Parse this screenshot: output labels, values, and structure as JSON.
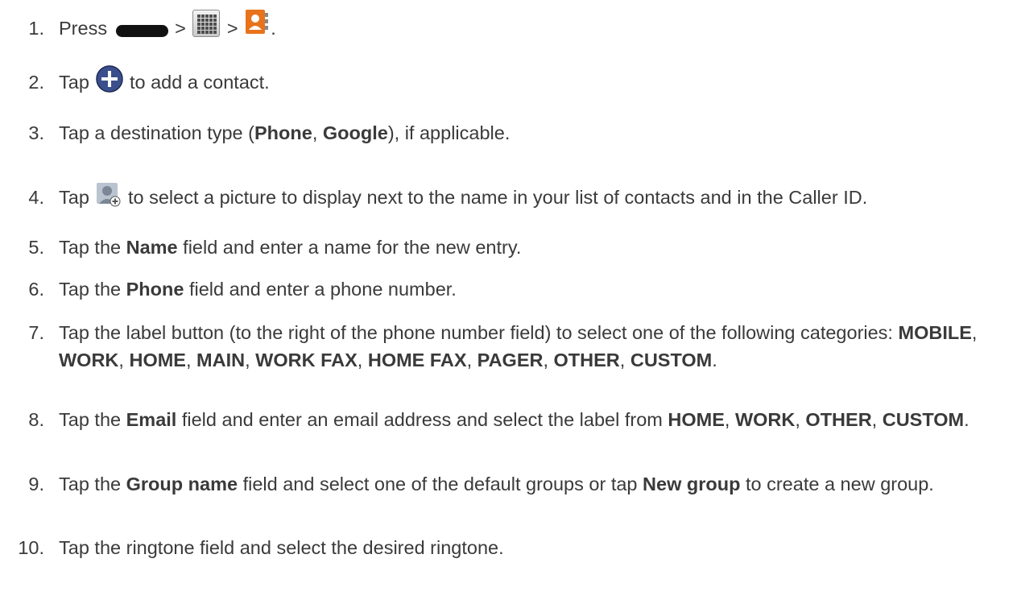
{
  "steps": [
    {
      "num": "1.",
      "parts": [
        {
          "t": "text",
          "v": "Press "
        },
        {
          "t": "icon",
          "name": "home-key-icon"
        },
        {
          "t": "text",
          "v": " > "
        },
        {
          "t": "icon",
          "name": "apps-icon"
        },
        {
          "t": "text",
          "v": " > "
        },
        {
          "t": "icon",
          "name": "contacts-icon"
        },
        {
          "t": "text",
          "v": "."
        }
      ]
    },
    {
      "num": "2.",
      "parts": [
        {
          "t": "text",
          "v": "Tap "
        },
        {
          "t": "icon",
          "name": "add-contact-icon"
        },
        {
          "t": "text",
          "v": " to add a contact."
        }
      ]
    },
    {
      "num": "3.",
      "parts": [
        {
          "t": "text",
          "v": "Tap a destination type ("
        },
        {
          "t": "bold",
          "v": "Phone"
        },
        {
          "t": "text",
          "v": ", "
        },
        {
          "t": "bold",
          "v": "Google"
        },
        {
          "t": "text",
          "v": "), if applicable."
        }
      ]
    },
    {
      "num": "4.",
      "parts": [
        {
          "t": "text",
          "v": "Tap "
        },
        {
          "t": "icon",
          "name": "contact-photo-icon"
        },
        {
          "t": "text",
          "v": " to select a picture to display next to the name in your list of contacts and in the Caller ID."
        }
      ]
    },
    {
      "num": "5.",
      "parts": [
        {
          "t": "text",
          "v": "Tap the "
        },
        {
          "t": "bold",
          "v": "Name"
        },
        {
          "t": "text",
          "v": " field and enter a name for the new entry."
        }
      ]
    },
    {
      "num": "6.",
      "parts": [
        {
          "t": "text",
          "v": "Tap the "
        },
        {
          "t": "bold",
          "v": "Phone"
        },
        {
          "t": "text",
          "v": " field and enter a phone number."
        }
      ]
    },
    {
      "num": "7.",
      "parts": [
        {
          "t": "text",
          "v": "Tap the label button (to the right of the phone number field) to select one of the following categories: "
        },
        {
          "t": "bold",
          "v": "MOBILE"
        },
        {
          "t": "text",
          "v": ", "
        },
        {
          "t": "bold",
          "v": "WORK"
        },
        {
          "t": "text",
          "v": ", "
        },
        {
          "t": "bold",
          "v": "HOME"
        },
        {
          "t": "text",
          "v": ", "
        },
        {
          "t": "bold",
          "v": "MAIN"
        },
        {
          "t": "text",
          "v": ", "
        },
        {
          "t": "bold",
          "v": "WORK FAX"
        },
        {
          "t": "text",
          "v": ", "
        },
        {
          "t": "bold",
          "v": "HOME FAX"
        },
        {
          "t": "text",
          "v": ", "
        },
        {
          "t": "bold",
          "v": "PAGER"
        },
        {
          "t": "text",
          "v": ", "
        },
        {
          "t": "bold",
          "v": "OTHER"
        },
        {
          "t": "text",
          "v": ", "
        },
        {
          "t": "bold",
          "v": "CUSTOM"
        },
        {
          "t": "text",
          "v": "."
        }
      ]
    },
    {
      "num": "8.",
      "parts": [
        {
          "t": "text",
          "v": "Tap the "
        },
        {
          "t": "bold",
          "v": "Email"
        },
        {
          "t": "text",
          "v": " field and enter an email address and select the label from "
        },
        {
          "t": "bold",
          "v": "HOME"
        },
        {
          "t": "text",
          "v": ", "
        },
        {
          "t": "bold",
          "v": "WORK"
        },
        {
          "t": "text",
          "v": ", "
        },
        {
          "t": "bold",
          "v": "OTHER"
        },
        {
          "t": "text",
          "v": ", "
        },
        {
          "t": "bold",
          "v": "CUSTOM"
        },
        {
          "t": "text",
          "v": "."
        }
      ]
    },
    {
      "num": "9.",
      "parts": [
        {
          "t": "text",
          "v": "Tap the "
        },
        {
          "t": "bold",
          "v": "Group name"
        },
        {
          "t": "text",
          "v": " field and select one of the default groups or tap "
        },
        {
          "t": "bold",
          "v": "New group"
        },
        {
          "t": "text",
          "v": " to create a new group."
        }
      ]
    },
    {
      "num": "10.",
      "parts": [
        {
          "t": "text",
          "v": "Tap the ringtone field and select the desired ringtone."
        }
      ]
    }
  ],
  "colors": {
    "text": "#3a3a3a",
    "add_icon": "#3b4f8c",
    "contacts_icon": "#e8731a"
  }
}
